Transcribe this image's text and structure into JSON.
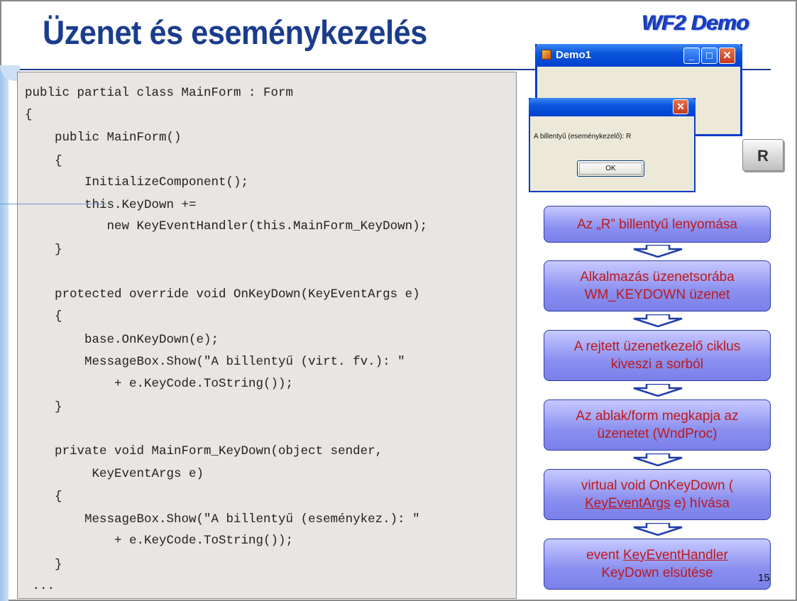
{
  "slide": {
    "title": "Üzenet és eseménykezelés",
    "logo": "WF2 Demo",
    "page_number": "15"
  },
  "code": {
    "lines": [
      "public partial class MainForm : Form",
      "{",
      "    public MainForm()",
      "    {",
      "        InitializeComponent();",
      "        this.KeyDown +=",
      "           new KeyEventHandler(this.MainForm_KeyDown);",
      "    }",
      "",
      "    protected override void OnKeyDown(KeyEventArgs e)",
      "    {",
      "        base.OnKeyDown(e);",
      "        MessageBox.Show(\"A billentyű (virt. fv.): \"",
      "            + e.KeyCode.ToString());",
      "    }",
      "",
      "    private void MainForm_KeyDown(object sender,",
      "         KeyEventArgs e)",
      "    {",
      "        MessageBox.Show(\"A billentyű (eseménykez.): \"",
      "            + e.KeyCode.ToString());",
      "    }",
      " ..."
    ]
  },
  "demo_window": {
    "title": "Demo1",
    "minimize_glyph": "_",
    "maximize_glyph": "□",
    "close_glyph": "✕"
  },
  "message_box": {
    "text": "A billentyű (eseménykezelő): R",
    "ok_label": "OK",
    "close_glyph": "✕"
  },
  "key": {
    "label": "R"
  },
  "flow": {
    "steps": [
      {
        "lines": [
          "Az „R” billentyű lenyomása"
        ]
      },
      {
        "lines": [
          "Alkalmazás üzenetsorába",
          "WM_KEYDOWN üzenet"
        ]
      },
      {
        "lines": [
          "A rejtett üzenetkezelő ciklus",
          "kiveszi a sorból"
        ]
      },
      {
        "lines": [
          "Az ablak/form megkapja az",
          "üzenetet (WndProc)"
        ]
      },
      {
        "lines": [
          "virtual void OnKeyDown (",
          "KeyEventArgs e) hívása"
        ],
        "underline": "KeyEventArgs"
      },
      {
        "lines": [
          "event KeyEventHandler",
          "KeyDown elsütése"
        ],
        "underline": "KeyEventHandler"
      }
    ]
  },
  "colors": {
    "title": "#1a3c8c",
    "flow_text": "#c0181a",
    "flow_fill": "#8a8ff0",
    "code_bg": "#e9e5e2"
  }
}
